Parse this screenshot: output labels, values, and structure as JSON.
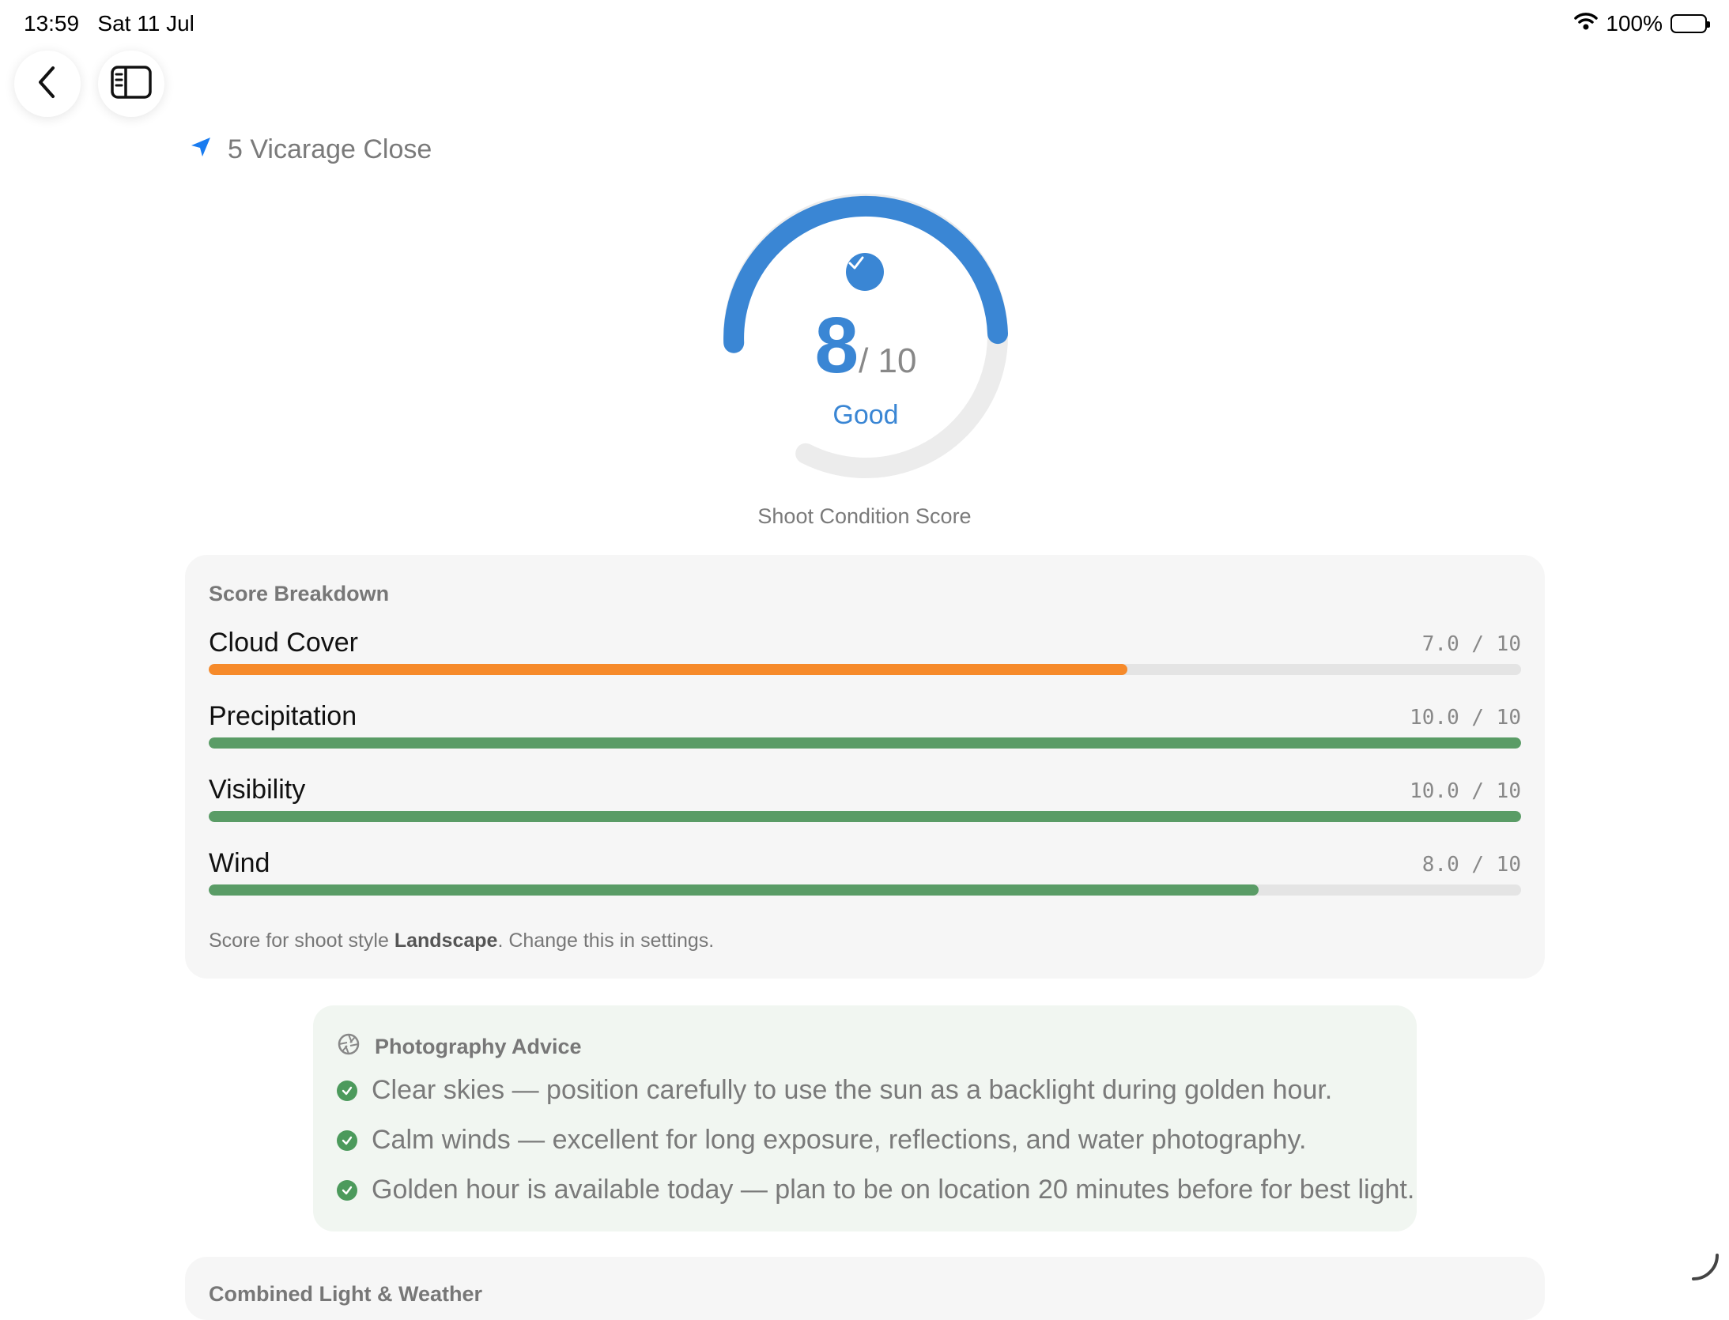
{
  "status_bar": {
    "time": "13:59",
    "date": "Sat 11 Jul",
    "battery": "100%"
  },
  "location": {
    "name": "5 Vicarage Close"
  },
  "gauge": {
    "score": "8",
    "max": "/ 10",
    "rating": "Good",
    "fraction": 0.8,
    "color": "#3a86d4"
  },
  "score_caption": "Shoot Condition Score",
  "breakdown": {
    "title": "Score Breakdown",
    "rows": [
      {
        "label": "Cloud Cover",
        "value": "7.0 / 10",
        "fraction": 0.7,
        "color": "#f68a2a"
      },
      {
        "label": "Precipitation",
        "value": "10.0 / 10",
        "fraction": 1.0,
        "color": "#5a9c66"
      },
      {
        "label": "Visibility",
        "value": "10.0 / 10",
        "fraction": 1.0,
        "color": "#5a9c66"
      },
      {
        "label": "Wind",
        "value": "8.0 / 10",
        "fraction": 0.8,
        "color": "#5a9c66"
      }
    ],
    "footer_prefix": "Score for shoot style ",
    "footer_style": "Landscape",
    "footer_suffix": ". Change this in settings."
  },
  "advice": {
    "title": "Photography Advice",
    "items": [
      "Clear skies — position carefully to use the sun as a backlight during golden hour.",
      "Calm winds — excellent for long exposure, reflections, and water photography.",
      "Golden hour is available today — plan to be on location 20 minutes before for best light."
    ]
  },
  "next_section": {
    "title": "Combined Light & Weather"
  }
}
